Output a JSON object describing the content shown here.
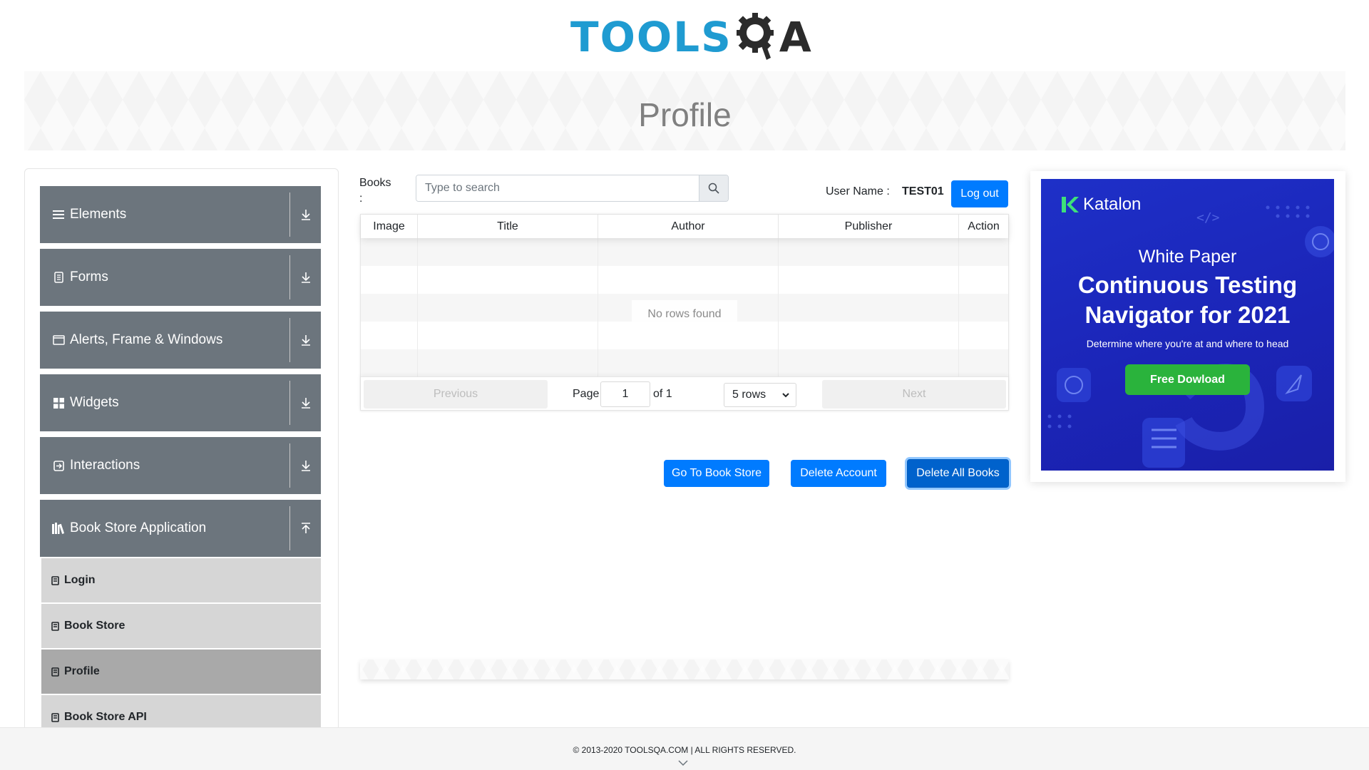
{
  "brand": {
    "logo_text_left": "TOOLS",
    "logo_text_right": "A"
  },
  "banner": {
    "title": "Profile"
  },
  "sidebar": {
    "groups": [
      {
        "label": "Elements",
        "icon": "hamburger-icon",
        "arrow": "download-arrow-icon"
      },
      {
        "label": "Forms",
        "icon": "form-icon",
        "arrow": "download-arrow-icon"
      },
      {
        "label": "Alerts, Frame & Windows",
        "icon": "window-icon",
        "arrow": "download-arrow-icon"
      },
      {
        "label": "Widgets",
        "icon": "widgets-grid-icon",
        "arrow": "download-arrow-icon"
      },
      {
        "label": "Interactions",
        "icon": "interactions-icon",
        "arrow": "download-arrow-icon"
      },
      {
        "label": "Book Store Application",
        "icon": "library-icon",
        "arrow": "upload-arrow-icon"
      }
    ],
    "bookstore_items": [
      {
        "label": "Login",
        "active": false
      },
      {
        "label": "Book Store",
        "active": false
      },
      {
        "label": "Profile",
        "active": true
      },
      {
        "label": "Book Store API",
        "active": false
      }
    ]
  },
  "main": {
    "books_label": "Books :",
    "search": {
      "placeholder": "Type to search",
      "value": ""
    },
    "user": {
      "label": "User Name :",
      "value": "TEST01"
    },
    "logout_label": "Log out",
    "table": {
      "columns": [
        "Image",
        "Title",
        "Author",
        "Publisher",
        "Action"
      ],
      "rows": [],
      "empty_text": "No rows found",
      "pagination": {
        "previous_label": "Previous",
        "next_label": "Next",
        "page_label": "Page",
        "page_value": "1",
        "of_label": "of 1",
        "rows_option": "5 rows"
      }
    },
    "actions": {
      "goto_store": "Go To Book Store",
      "delete_account": "Delete Account",
      "delete_all": "Delete All Books"
    }
  },
  "ad": {
    "brand": "Katalon",
    "kicker": "White Paper",
    "title_line1": "Continuous Testing",
    "title_line2": "Navigator for 2021",
    "subtitle": "Determine where you're at and where to head",
    "cta": "Free Dowload",
    "colors": {
      "background": "#1e2fc4",
      "cta": "#2ab33c"
    }
  },
  "footer": {
    "text": "© 2013-2020 TOOLSQA.COM | ALL RIGHTS RESERVED."
  },
  "colors": {
    "primary": "#007bff",
    "sidebar_header": "#6c757d",
    "sidebar_item": "#d6d6d6",
    "sidebar_item_active": "#a9a9a9",
    "logo_blue": "#1f9bd1"
  }
}
